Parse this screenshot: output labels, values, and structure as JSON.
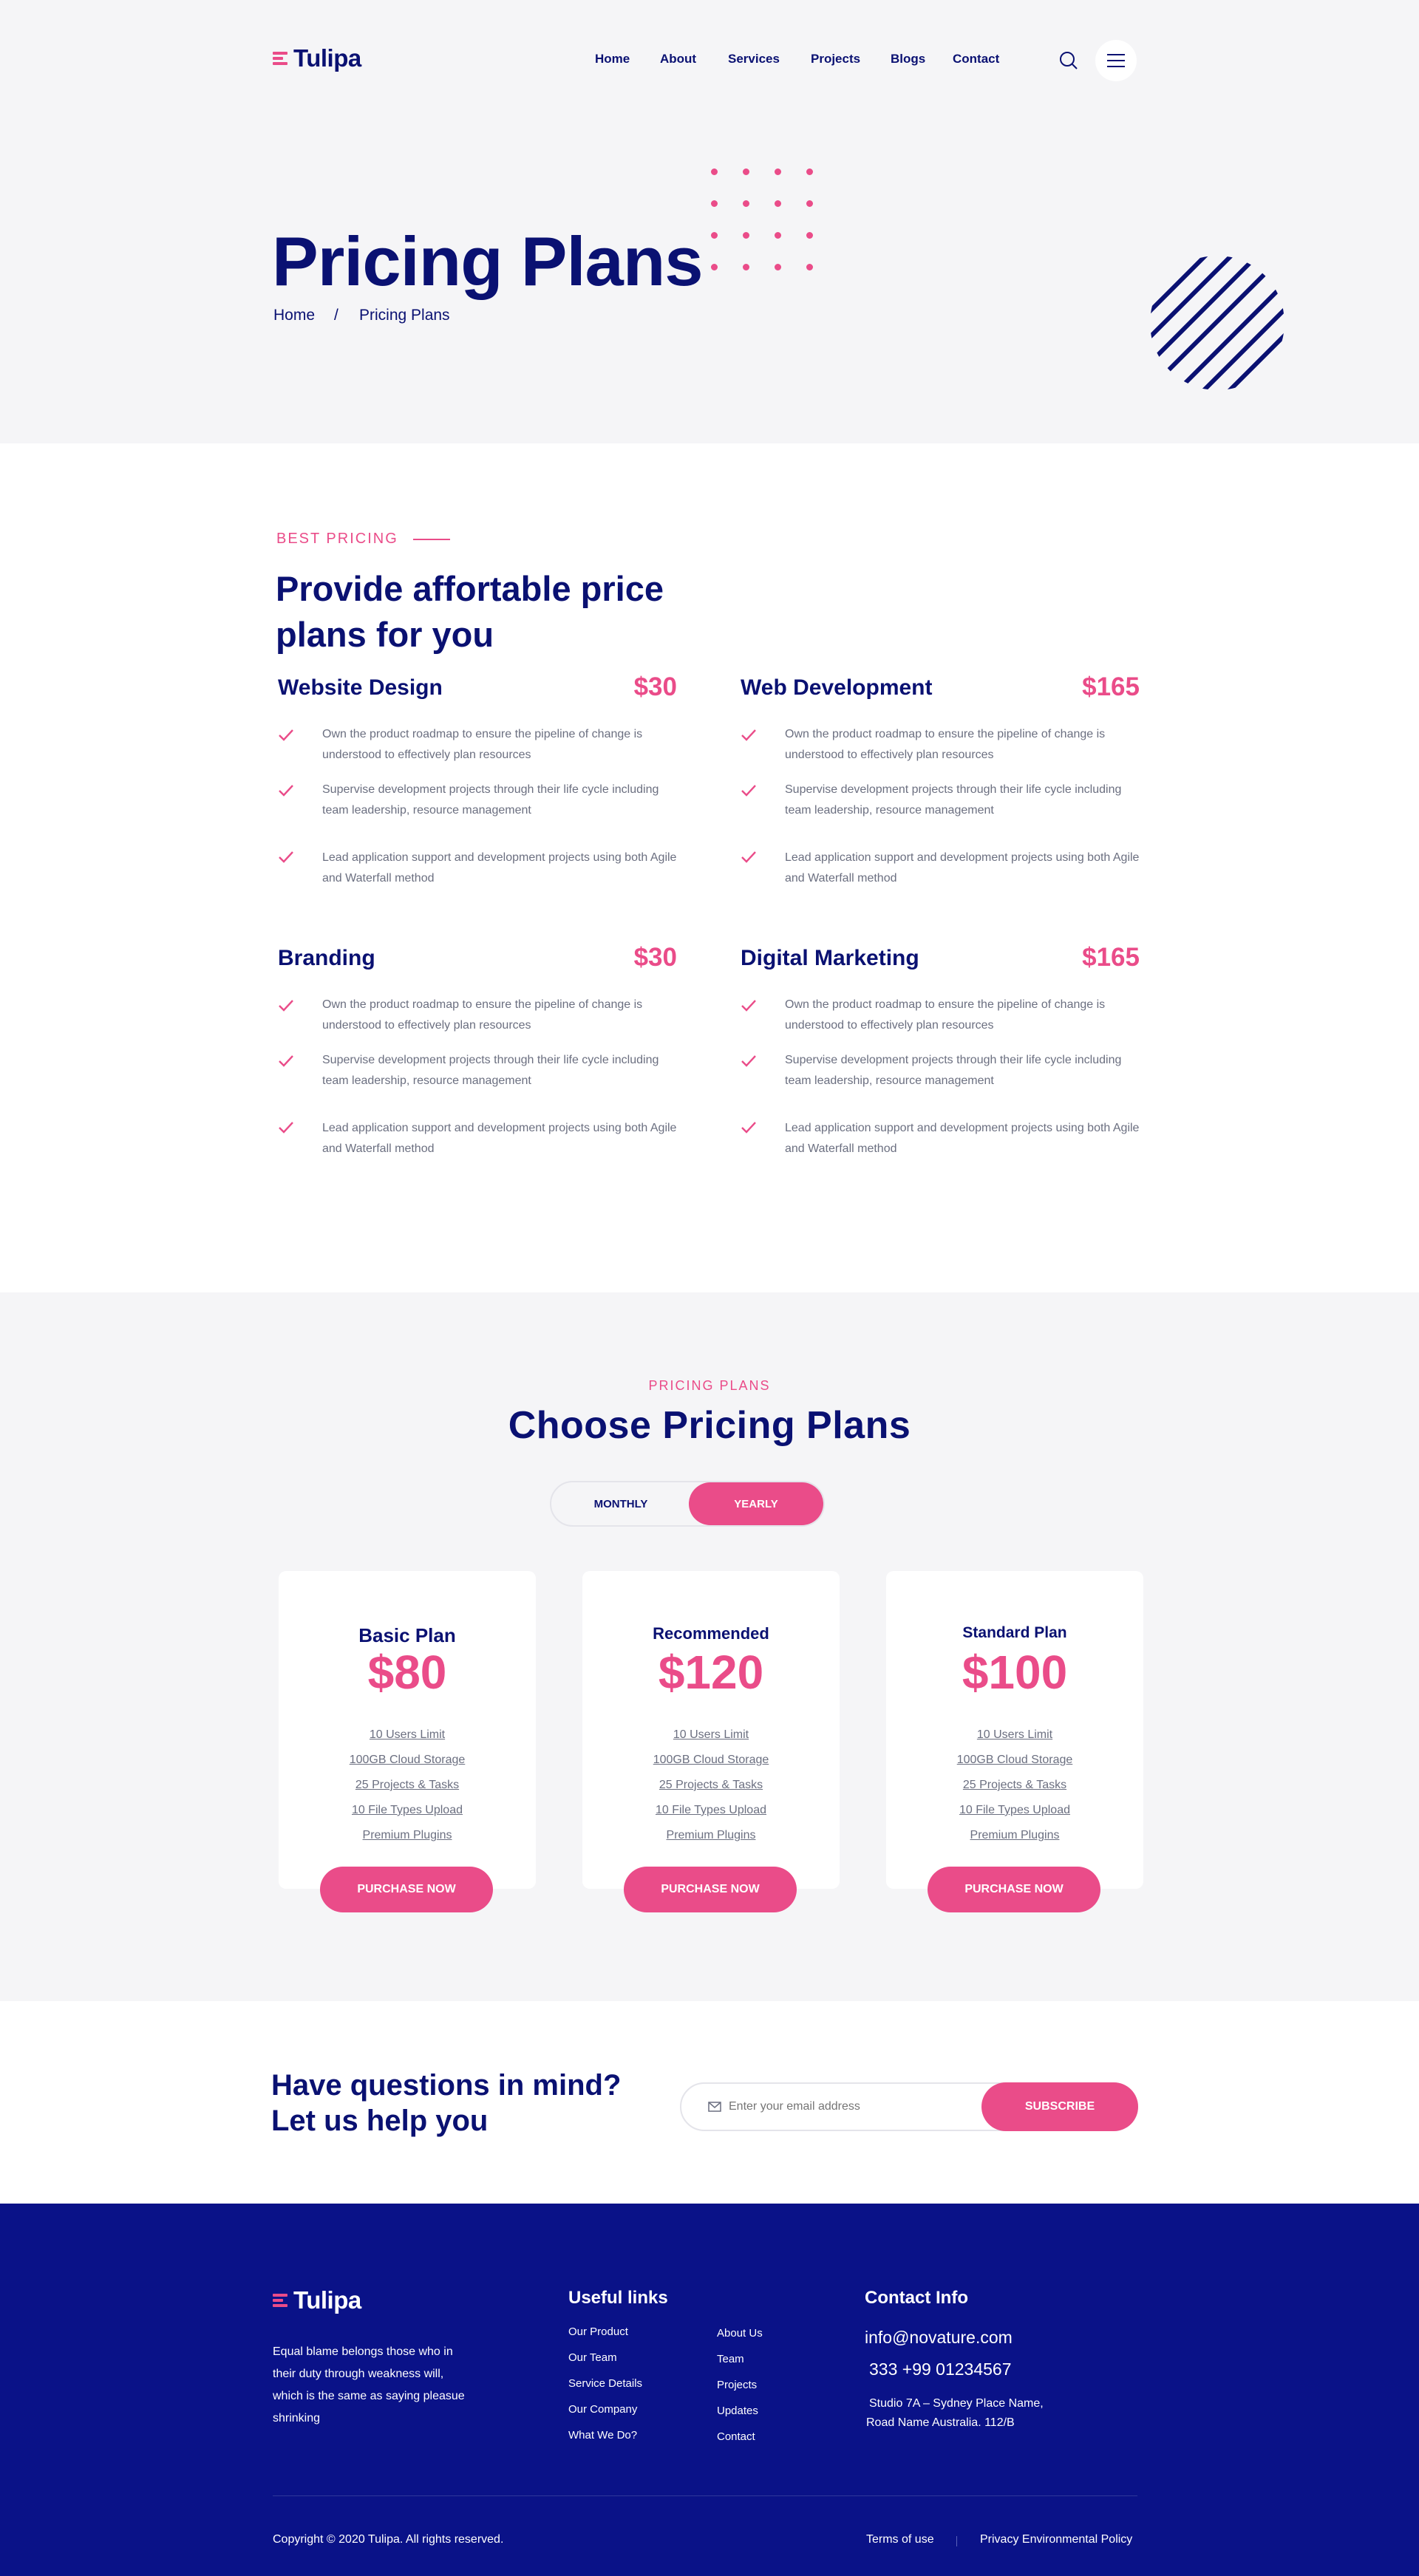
{
  "header": {
    "logo_text": "Tulipa",
    "nav": [
      "Home",
      "About",
      "Services",
      "Projects",
      "Blogs",
      "Contact"
    ]
  },
  "hero": {
    "title": "Pricing Plans",
    "breadcrumb": {
      "home": "Home",
      "separator": "/",
      "current": "Pricing Plans"
    }
  },
  "best_pricing": {
    "kicker": "BEST PRICING",
    "title": "Provide affortable price plans for you",
    "services": [
      {
        "name": "Website Design",
        "price": "$30",
        "items": [
          "Own the product roadmap to ensure the pipeline of change is understood to effectively plan resources",
          "Supervise development projects through their life cycle including team leadership, resource management",
          "Lead application support and development projects using both Agile and Waterfall method"
        ]
      },
      {
        "name": "Web Development",
        "price": "$165",
        "items": [
          "Own the product roadmap to ensure the pipeline of change is understood to effectively plan resources",
          "Supervise development projects through their life cycle including team leadership, resource management",
          "Lead application support and development projects using both Agile and Waterfall method"
        ]
      },
      {
        "name": "Branding",
        "price": "$30",
        "items": [
          "Own the product roadmap to ensure the pipeline of change is understood to effectively plan resources",
          "Supervise development projects through their life cycle including team leadership, resource management",
          "Lead application support and development projects using both Agile and Waterfall method"
        ]
      },
      {
        "name": "Digital Marketing",
        "price": "$165",
        "items": [
          "Own the product roadmap to ensure the pipeline of change is understood to effectively plan resources",
          "Supervise development projects through their life cycle including team leadership, resource management",
          "Lead application support and development projects using both Agile and Waterfall method"
        ]
      }
    ]
  },
  "choose": {
    "kicker": "PRICING PLANS",
    "title": "Choose Pricing Plans",
    "toggle": {
      "monthly": "MONTHLY",
      "yearly": "YEARLY",
      "active": "yearly"
    },
    "plans": [
      {
        "name": "Basic Plan",
        "price": "$80",
        "features": [
          "10 Users Limit",
          "100GB Cloud Storage",
          "25 Projects & Tasks",
          "10 File Types Upload",
          "Premium Plugins"
        ],
        "button": "PURCHASE NOW"
      },
      {
        "name": "Recommended",
        "price": "$120",
        "features": [
          "10 Users Limit",
          "100GB Cloud Storage",
          "25 Projects & Tasks",
          "10 File Types Upload",
          "Premium Plugins"
        ],
        "button": "PURCHASE NOW"
      },
      {
        "name": "Standard Plan",
        "price": "$100",
        "features": [
          "10 Users Limit",
          "100GB Cloud Storage",
          "25 Projects & Tasks",
          "10 File Types Upload",
          "Premium Plugins"
        ],
        "button": "PURCHASE NOW"
      }
    ]
  },
  "newsletter": {
    "title_line1": "Have questions in mind?",
    "title_line2": "Let us help you",
    "placeholder": "Enter your email address",
    "button": "SUBSCRIBE"
  },
  "footer": {
    "logo_text": "Tulipa",
    "about": "Equal blame belongs those who in their duty through weakness will, which is the same as saying pleasue shrinking",
    "useful_links_title": "Useful links",
    "links_col1": [
      "Our Product",
      "Our Team",
      "Service Details",
      "Our Company",
      "What We Do?"
    ],
    "links_col2": [
      "About Us",
      "Team",
      "Projects",
      "Updates",
      "Contact"
    ],
    "contact_title": "Contact Info",
    "email": "info@novature.com",
    "phone": "333 +99 01234567",
    "address_line1": "Studio 7A – Sydney Place Name,",
    "address_line2": "Road Name Australia. 112/B",
    "copyright": "Copyright © 2020 Tulipa. All rights reserved.",
    "terms": "Terms of use",
    "privacy": "Privacy Environmental Policy"
  },
  "colors": {
    "navy": "#0a1172",
    "pink": "#ea4c89",
    "footer_bg": "#0a1288",
    "light_bg": "#f5f5f7"
  },
  "icons": [
    "logo-mark-icon",
    "search-icon",
    "menu-icon",
    "check-icon",
    "mail-icon"
  ]
}
